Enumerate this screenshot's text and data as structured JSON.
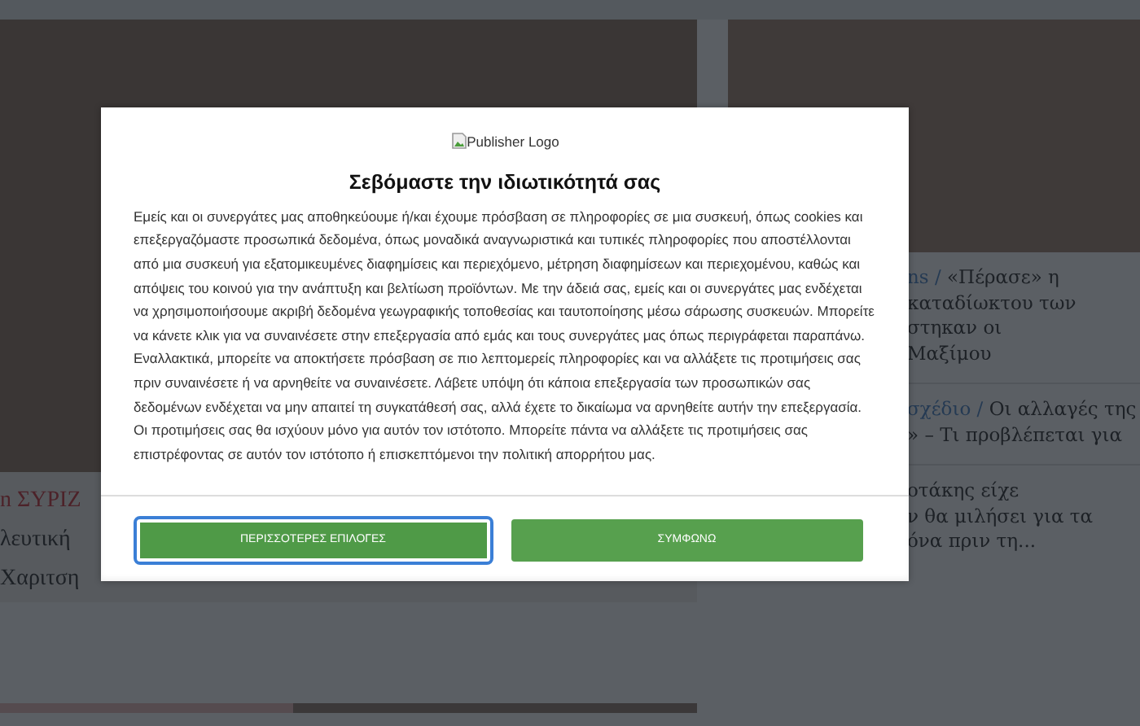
{
  "background": {
    "left_story": {
      "category": "n ΣΥΡΙΖ",
      "lines": [
        "λευτική",
        "Χαριτση"
      ]
    },
    "right_stories": [
      {
        "category": "ns",
        "separator": "/",
        "lines": [
          "«Πέρασε» η",
          "καταδίωκτου των",
          "στηκαν οι",
          "Μαξίμου"
        ]
      },
      {
        "category": "σχέδιο",
        "separator": "/",
        "lines": [
          "Οι αλλαγές της",
          "» – Τι προβλέπεται για"
        ]
      },
      {
        "lines": [
          "οτάκης είχε",
          "ν θα μιλήσει για τα",
          "όνα πριν τη..."
        ]
      }
    ]
  },
  "dialog": {
    "logo_alt": "Publisher Logo",
    "title": "Σεβόμαστε την ιδιωτικότητά σας",
    "body": "Εμείς και οι συνεργάτες μας αποθηκεύουμε ή/και έχουμε πρόσβαση σε πληροφορίες σε μια συσκευή, όπως cookies και επεξεργαζόμαστε προσωπικά δεδομένα, όπως μοναδικά αναγνωριστικά και τυπικές πληροφορίες που αποστέλλονται από μια συσκευή για εξατομικευμένες διαφημίσεις και περιεχόμενο, μέτρηση διαφημίσεων και περιεχομένου, καθώς και απόψεις του κοινού για την ανάπτυξη και βελτίωση προϊόντων. Με την άδειά σας, εμείς και οι συνεργάτες μας ενδέχεται να χρησιμοποιήσουμε ακριβή δεδομένα γεωγραφικής τοποθεσίας και ταυτοποίησης μέσω σάρωσης συσκευών. Μπορείτε να κάνετε κλικ για να συναινέσετε στην επεξεργασία από εμάς και τους συνεργάτες μας όπως περιγράφεται παραπάνω. Εναλλακτικά, μπορείτε να αποκτήσετε πρόσβαση σε πιο λεπτομερείς πληροφορίες και να αλλάξετε τις προτιμήσεις σας πριν συναινέσετε ή να αρνηθείτε να συναινέσετε. Λάβετε υπόψη ότι κάποια επεξεργασία των προσωπικών σας δεδομένων ενδέχεται να μην απαιτεί τη συγκατάθεσή σας, αλλά έχετε το δικαίωμα να αρνηθείτε αυτήν την επεξεργασία. Οι προτιμήσεις σας θα ισχύουν μόνο για αυτόν τον ιστότοπο. Μπορείτε πάντα να αλλάξετε τις προτιμήσεις σας επιστρέφοντας σε αυτόν τον ιστότοπο ή επισκεπτόμενοι την πολιτική απορρήτου μας.",
    "buttons": [
      {
        "label": "ΠΕΡΙΣΣΟΤΕΡΕΣ ΕΠΙΛΟΓΕΣ",
        "focused": true
      },
      {
        "label": "ΣΥΜΦΩΝΩ",
        "focused": false
      }
    ]
  }
}
